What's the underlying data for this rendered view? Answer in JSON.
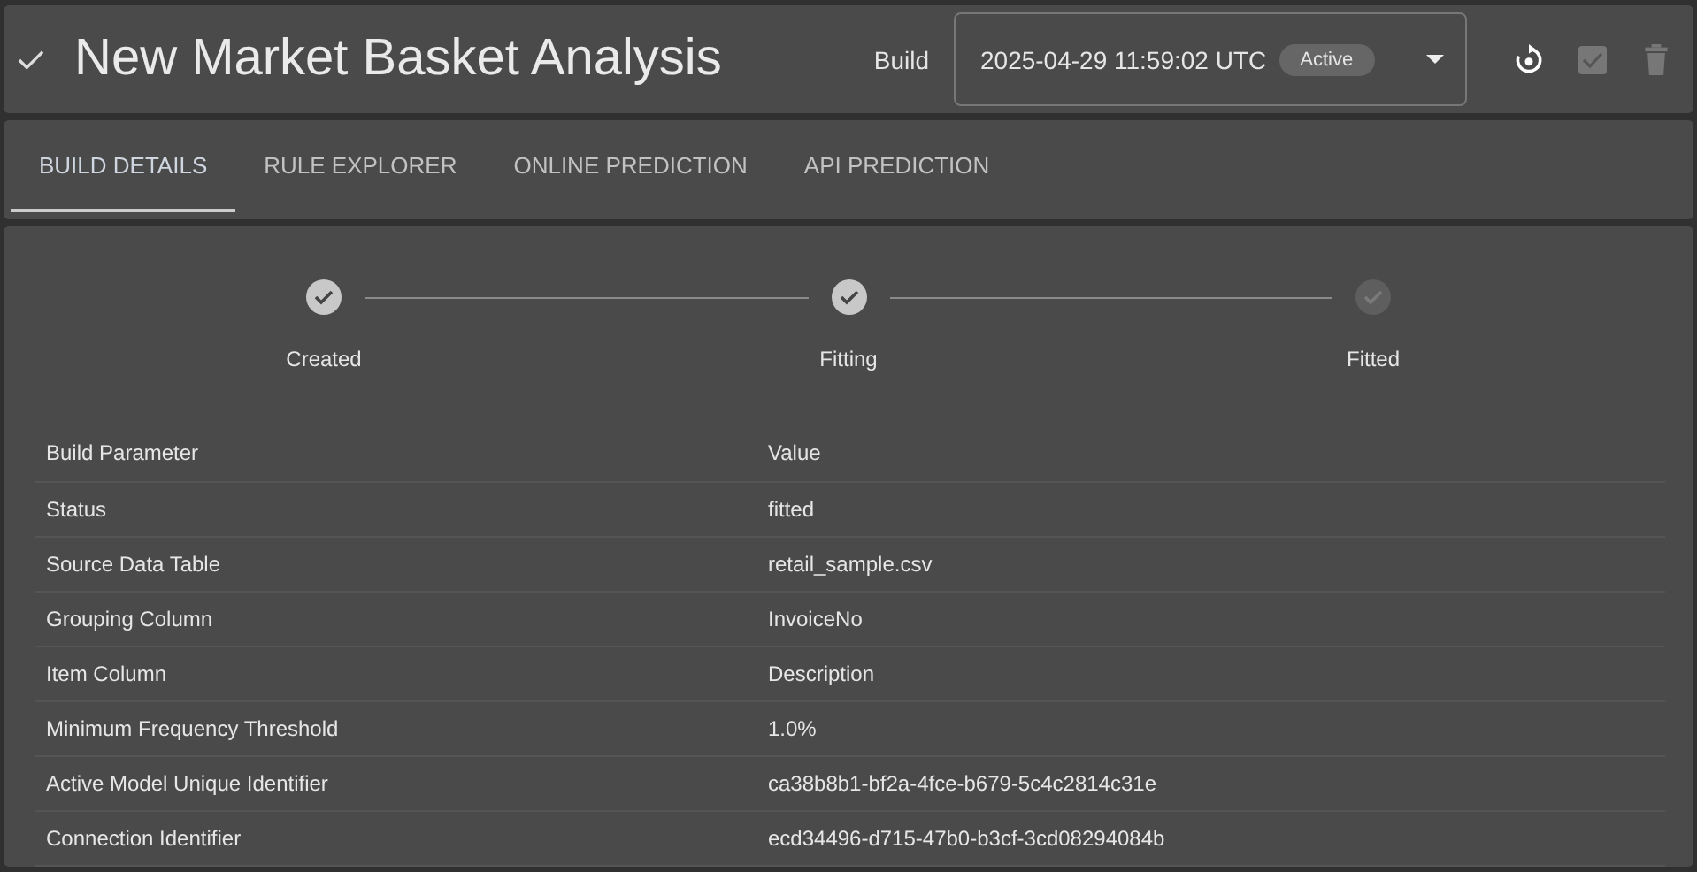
{
  "header": {
    "title": "New Market Basket Analysis",
    "build_label": "Build",
    "build_select": {
      "value": "2025-04-29 11:59:02 UTC",
      "badge": "Active"
    }
  },
  "tabs": [
    {
      "label": "BUILD DETAILS",
      "selected": true
    },
    {
      "label": "RULE EXPLORER",
      "selected": false
    },
    {
      "label": "ONLINE PREDICTION",
      "selected": false
    },
    {
      "label": "API PREDICTION",
      "selected": false
    }
  ],
  "steps": [
    {
      "label": "Created",
      "done": true
    },
    {
      "label": "Fitting",
      "done": true
    },
    {
      "label": "Fitted",
      "done": false
    }
  ],
  "table": {
    "columns": [
      "Build Parameter",
      "Value"
    ],
    "rows": [
      [
        "Status",
        "fitted"
      ],
      [
        "Source Data Table",
        "retail_sample.csv"
      ],
      [
        "Grouping Column",
        "InvoiceNo"
      ],
      [
        "Item Column",
        "Description"
      ],
      [
        "Minimum Frequency Threshold",
        "1.0%"
      ],
      [
        "Active Model Unique Identifier",
        "ca38b8b1-bf2a-4fce-b679-5c4c2814c31e"
      ],
      [
        "Connection Identifier",
        "ecd34496-d715-47b0-b3cf-3cd08294084b"
      ]
    ]
  }
}
